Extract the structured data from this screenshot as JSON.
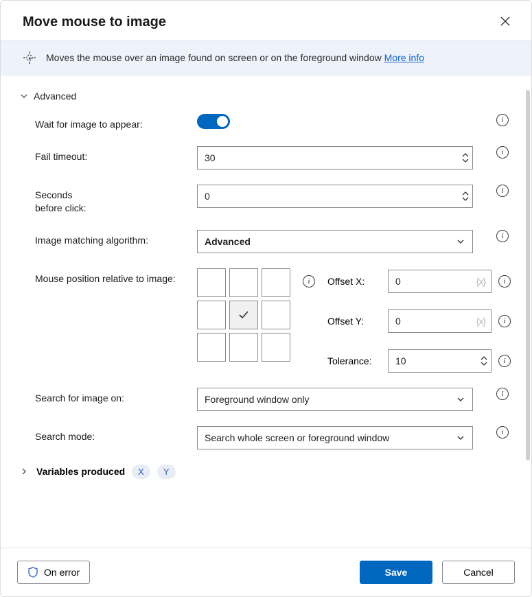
{
  "dialog": {
    "title": "Move mouse to image",
    "banner_text": "Moves the mouse over an image found on screen or on the foreground window ",
    "more_info": "More info"
  },
  "sections": {
    "advanced_label": "Advanced",
    "variables_label": "Variables produced"
  },
  "fields": {
    "wait_label": "Wait for image to appear:",
    "fail_timeout_label": "Fail timeout:",
    "fail_timeout_value": "30",
    "seconds_before_label": "Seconds\nbefore click:",
    "seconds_before_value": "0",
    "algo_label": "Image matching algorithm:",
    "algo_value": "Advanced",
    "pos_label": "Mouse position relative to image:",
    "offset_x_label": "Offset X:",
    "offset_x_value": "0",
    "offset_y_label": "Offset Y:",
    "offset_y_value": "0",
    "tolerance_label": "Tolerance:",
    "tolerance_value": "10",
    "search_on_label": "Search for image on:",
    "search_on_value": "Foreground window only",
    "search_mode_label": "Search mode:",
    "search_mode_value": "Search whole screen or foreground window"
  },
  "variables": {
    "x": "X",
    "y": "Y"
  },
  "footer": {
    "on_error": "On error",
    "save": "Save",
    "cancel": "Cancel"
  },
  "placeholders": {
    "var": "{x}"
  }
}
